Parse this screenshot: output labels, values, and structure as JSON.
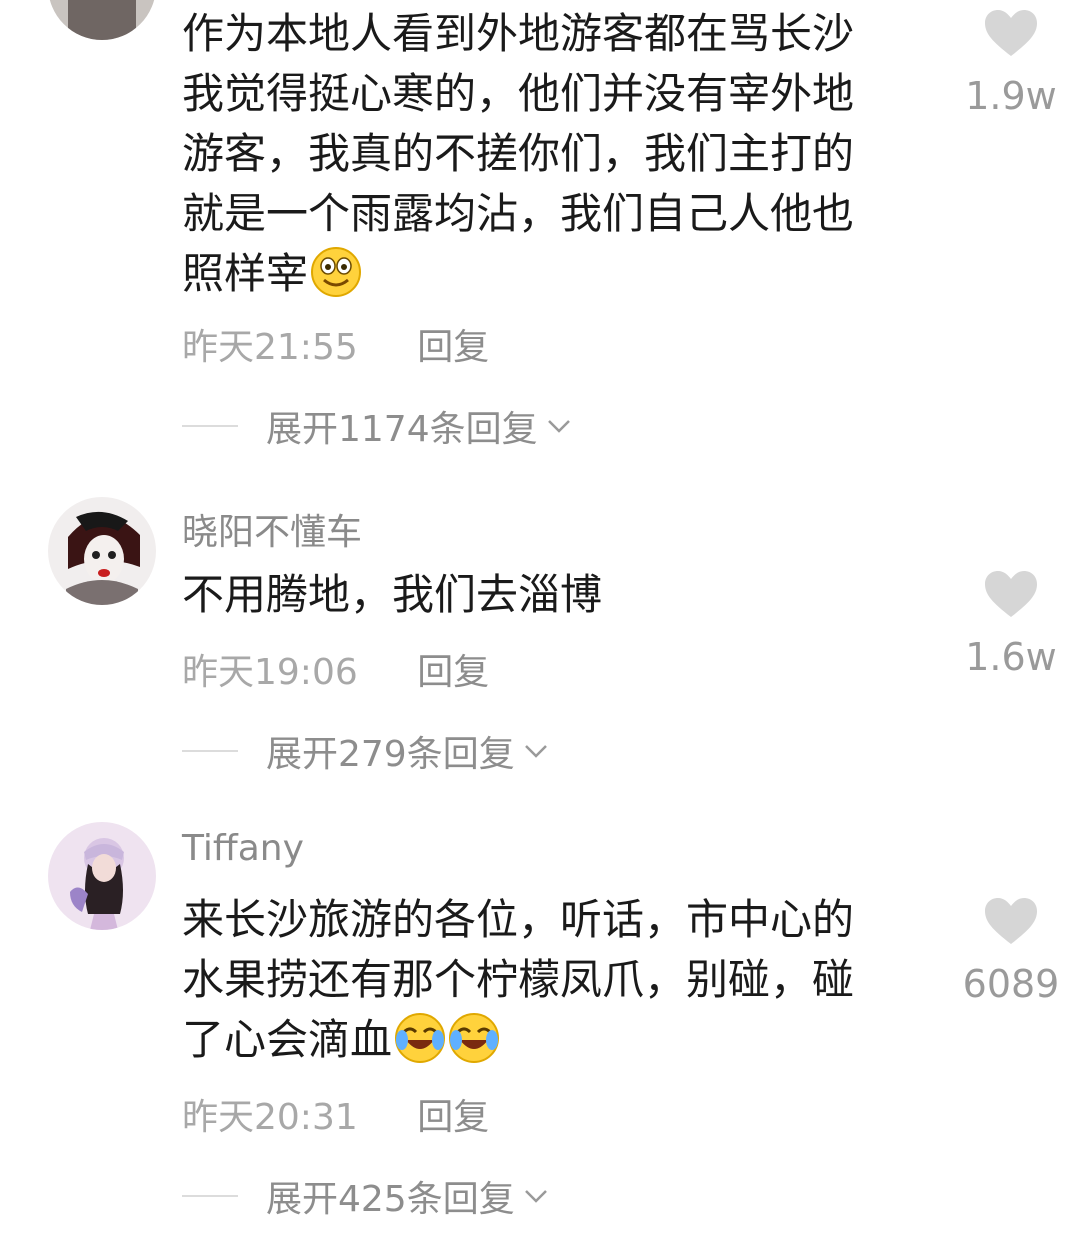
{
  "comments": [
    {
      "username": "",
      "text_lines": [
        "作为本地人看到外地游客都在骂长沙",
        "我觉得挺心寒的，他们并没有宰外地",
        "游客，我真的不搓你们，我们主打的",
        "就是一个雨露均沾，我们自己人他也",
        "照样宰"
      ],
      "emoji": "smile-emoji",
      "time": "昨天21:55",
      "reply_label": "回复",
      "expand_label": "展开1174条回复",
      "likes": "1.9w"
    },
    {
      "username": "晓阳不懂车",
      "text_lines": [
        "不用腾地，我们去淄博"
      ],
      "time": "昨天19:06",
      "reply_label": "回复",
      "expand_label": "展开279条回复",
      "likes": "1.6w"
    },
    {
      "username": "Tiffany",
      "text_lines": [
        "来长沙旅游的各位，听话，市中心的",
        "水果捞还有那个柠檬凤爪，别碰，碰",
        "了心会滴血"
      ],
      "emoji": "crying-laugh-emoji",
      "time": "昨天20:31",
      "reply_label": "回复",
      "expand_label": "展开425条回复",
      "likes": "6089"
    }
  ],
  "colors": {
    "text": "#1a1a1a",
    "muted": "#a8a8a8",
    "heart": "#d6d6d6"
  },
  "icons": [
    "heart-icon",
    "chevron-down-icon",
    "avatar"
  ]
}
